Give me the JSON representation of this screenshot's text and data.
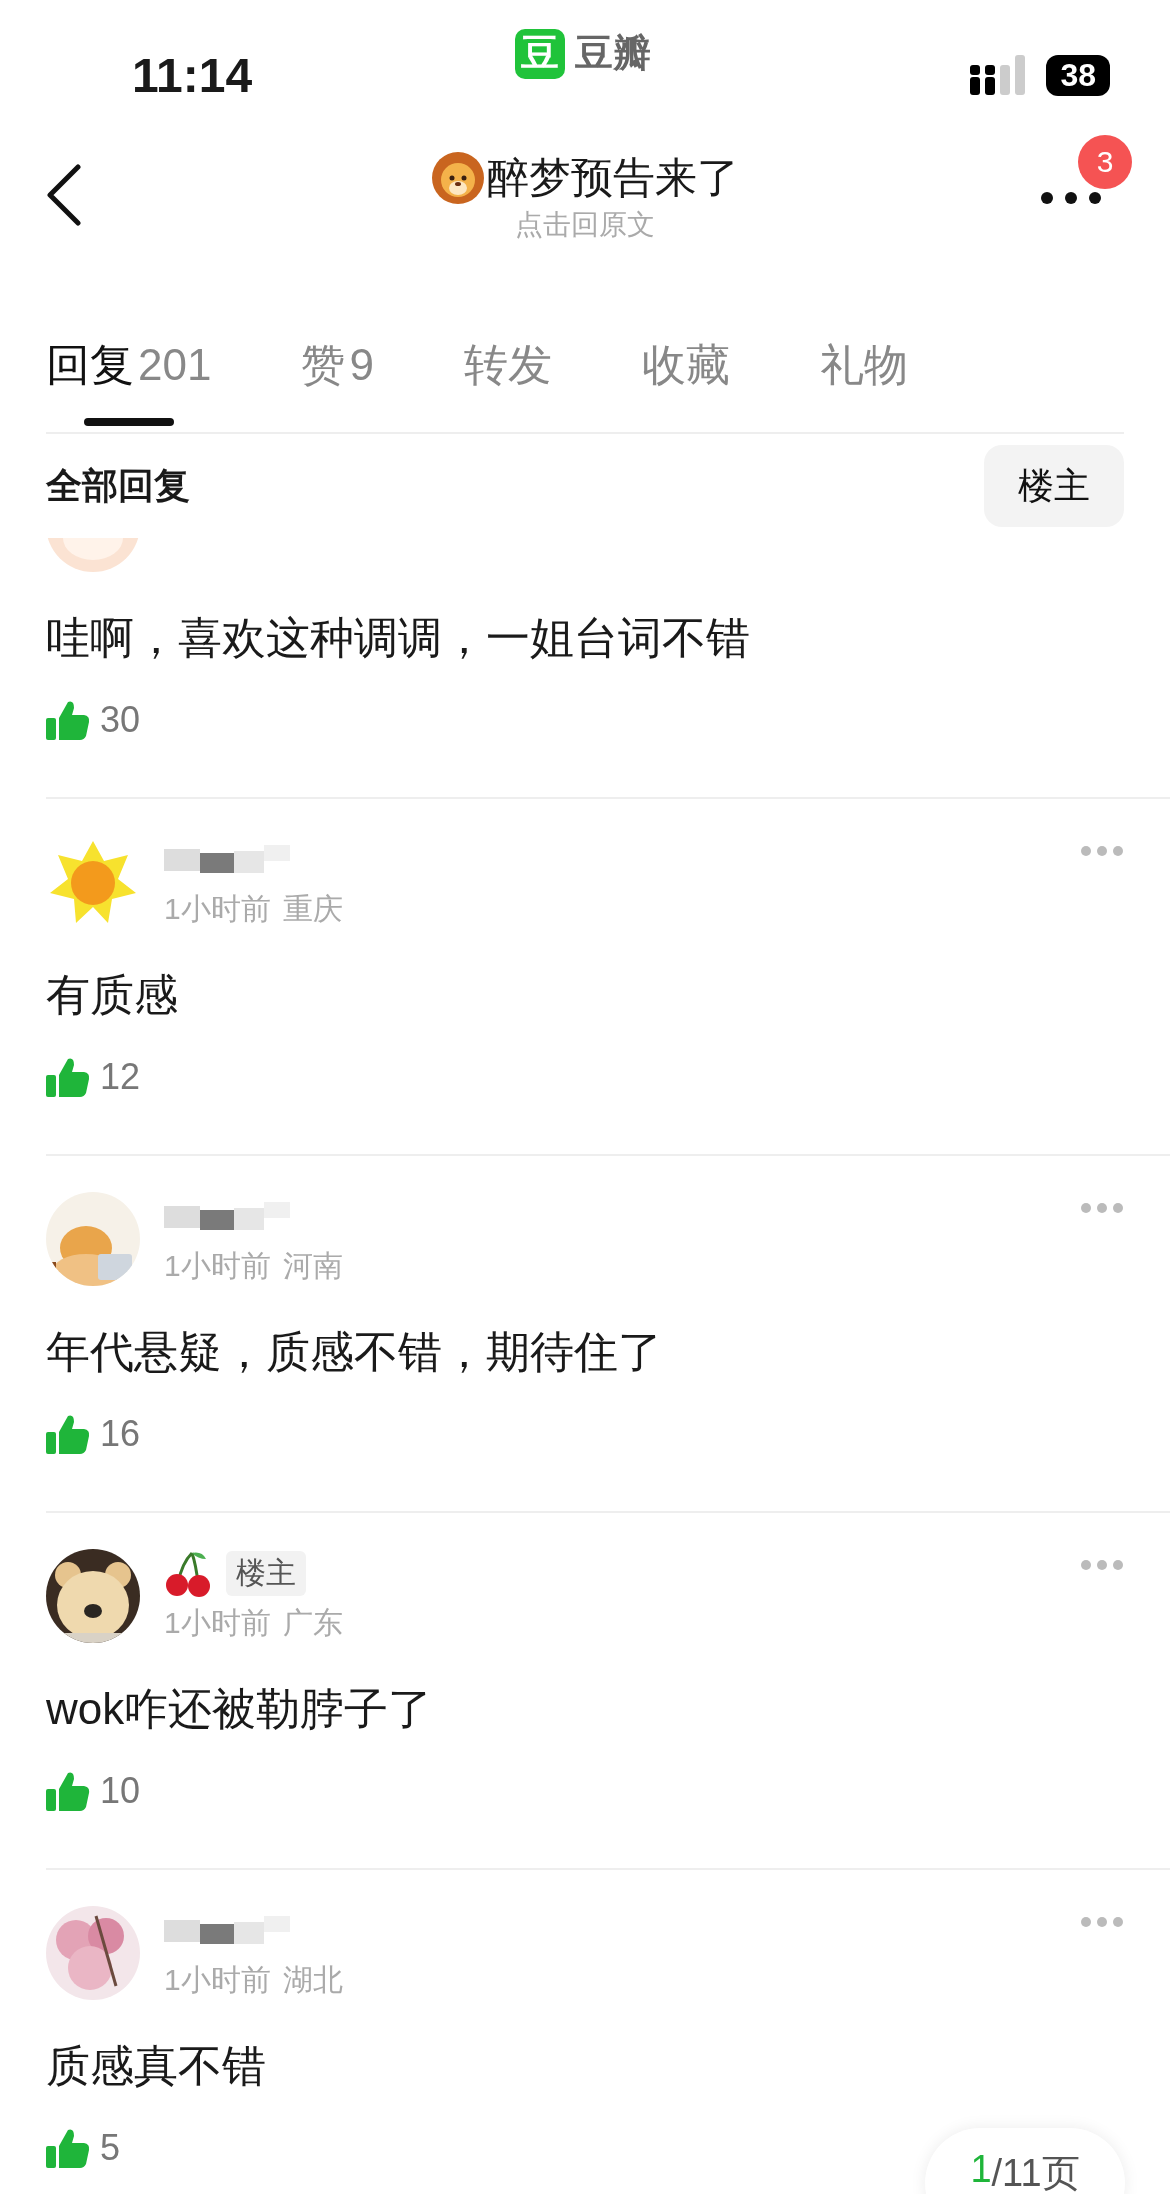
{
  "status_bar": {
    "time": "11:14",
    "app_name": "豆瓣",
    "app_logo": "豆",
    "battery": "38"
  },
  "nav": {
    "title": "醉梦预告来了",
    "subtitle": "点击回原文",
    "badge": "3"
  },
  "tabs": [
    {
      "label": "回复",
      "count": "201",
      "selected": true
    },
    {
      "label": "赞",
      "count": "9",
      "selected": false
    },
    {
      "label": "转发",
      "selected": false
    },
    {
      "label": "收藏",
      "selected": false
    },
    {
      "label": "礼物",
      "selected": false
    }
  ],
  "filter": {
    "label": "全部回复",
    "button": "楼主"
  },
  "comments": [
    {
      "text": "哇啊，喜欢这种调调，一姐台词不错",
      "likes": "30"
    },
    {
      "author": {
        "kind": "blurred"
      },
      "time": "1小时前",
      "location": "重庆",
      "text": "有质感",
      "likes": "12"
    },
    {
      "author": {
        "kind": "blurred"
      },
      "time": "1小时前",
      "location": "河南",
      "text": "年代悬疑，质感不错，期待住了",
      "likes": "16"
    },
    {
      "author": {
        "kind": "cherry",
        "badge": "楼主"
      },
      "time": "1小时前",
      "location": "广东",
      "text": "wok咋还被勒脖子了",
      "likes": "10"
    },
    {
      "author": {
        "kind": "blurred"
      },
      "time": "1小时前",
      "location": "湖北",
      "text": "质感真不错",
      "likes": "5"
    }
  ],
  "pager": {
    "current": "1",
    "total": "/11页"
  }
}
